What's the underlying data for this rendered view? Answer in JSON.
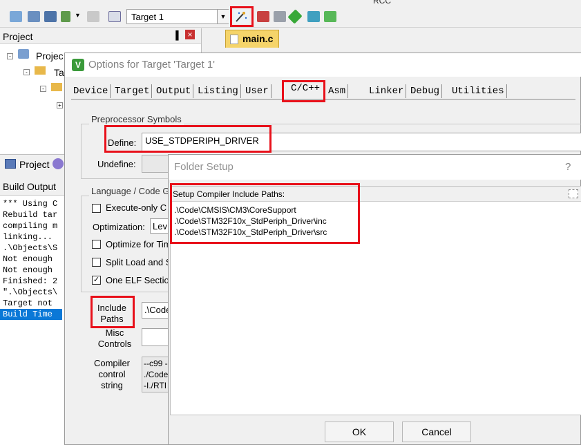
{
  "toolbar": {
    "target_select": "Target 1",
    "top_tab_partial": "RCC"
  },
  "left_pane": {
    "project_title": "Project",
    "pin_glyph": "▐",
    "close_glyph": "×",
    "tree": [
      {
        "label": "Projec"
      },
      {
        "label": "Ta"
      }
    ],
    "bottom_tab": "Project",
    "build_title": "Build Output",
    "build_lines": [
      "*** Using C",
      "Rebuild tar",
      "compiling m",
      "linking...",
      ".\\Objects\\S",
      "Not enough",
      "Not enough",
      "Finished: 2",
      "\".\\Objects\\",
      "Target not",
      "Build Time"
    ]
  },
  "editor": {
    "file_tab": "main.c"
  },
  "options_dialog": {
    "title": "Options for Target 'Target 1'",
    "tabs": [
      "Device",
      "Target",
      "Output",
      "Listing",
      "User",
      "C/C++",
      "Asm",
      "Linker",
      "Debug",
      "Utilities"
    ],
    "preprocessor_group": "Preprocessor Symbols",
    "define_label": "Define:",
    "define_value": "USE_STDPERIPH_DRIVER",
    "undefine_label": "Undefine:",
    "language_group": "Language / Code G",
    "execute_only": "Execute-only C",
    "optimization_label": "Optimization:",
    "optimization_value": "Lev",
    "optimize_time": "Optimize for Tim",
    "split_load": "Split Load and S",
    "one_elf": "One ELF Sectio",
    "include_label_1": "Include",
    "include_label_2": "Paths",
    "include_value": ".\\Code",
    "misc_label_1": "Misc",
    "misc_label_2": "Controls",
    "compiler_label_1": "Compiler",
    "compiler_label_2": "control",
    "compiler_label_3": "string",
    "compiler_lines": [
      "--c99 -",
      "./Code",
      "-I./RTI"
    ]
  },
  "folder_dialog": {
    "title": "Folder Setup",
    "help": "?",
    "list_header": "Setup Compiler Include Paths:",
    "paths": [
      ".\\Code\\CMSIS\\CM3\\CoreSupport",
      ".\\Code\\STM32F10x_StdPeriph_Driver\\inc",
      ".\\Code\\STM32F10x_StdPeriph_Driver\\src"
    ],
    "ok": "OK",
    "cancel": "Cancel"
  }
}
